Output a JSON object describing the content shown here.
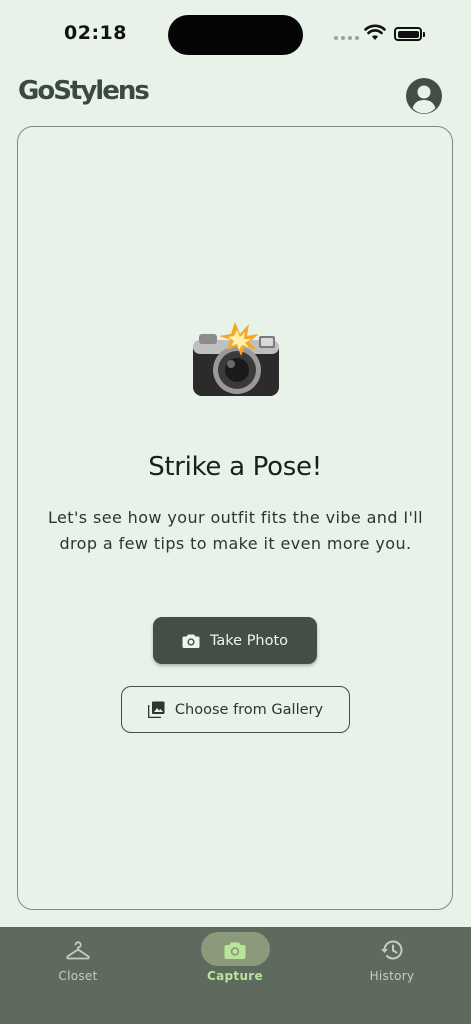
{
  "status_bar": {
    "time": "02:18"
  },
  "header": {
    "app_name": "GoStylens",
    "profile_icon": "account-circle-icon"
  },
  "capture_card": {
    "emoji": "camera-with-flash-icon",
    "headline": "Strike a Pose!",
    "description": "Let's see how your outfit fits the vibe and I'll drop a few tips to make it even more you.",
    "take_photo_label": "Take Photo",
    "take_photo_icon": "camera-icon",
    "gallery_label": "Choose from Gallery",
    "gallery_icon": "photo-library-icon"
  },
  "bottom_nav": {
    "items": [
      {
        "label": "Closet",
        "icon": "hanger-icon",
        "active": false
      },
      {
        "label": "Capture",
        "icon": "camera-icon",
        "active": true
      },
      {
        "label": "History",
        "icon": "history-icon",
        "active": false
      }
    ]
  },
  "colors": {
    "background": "#e8f2e8",
    "primary": "#434e44",
    "nav_background": "#5f6a5f",
    "nav_active": "#b8e59a"
  }
}
